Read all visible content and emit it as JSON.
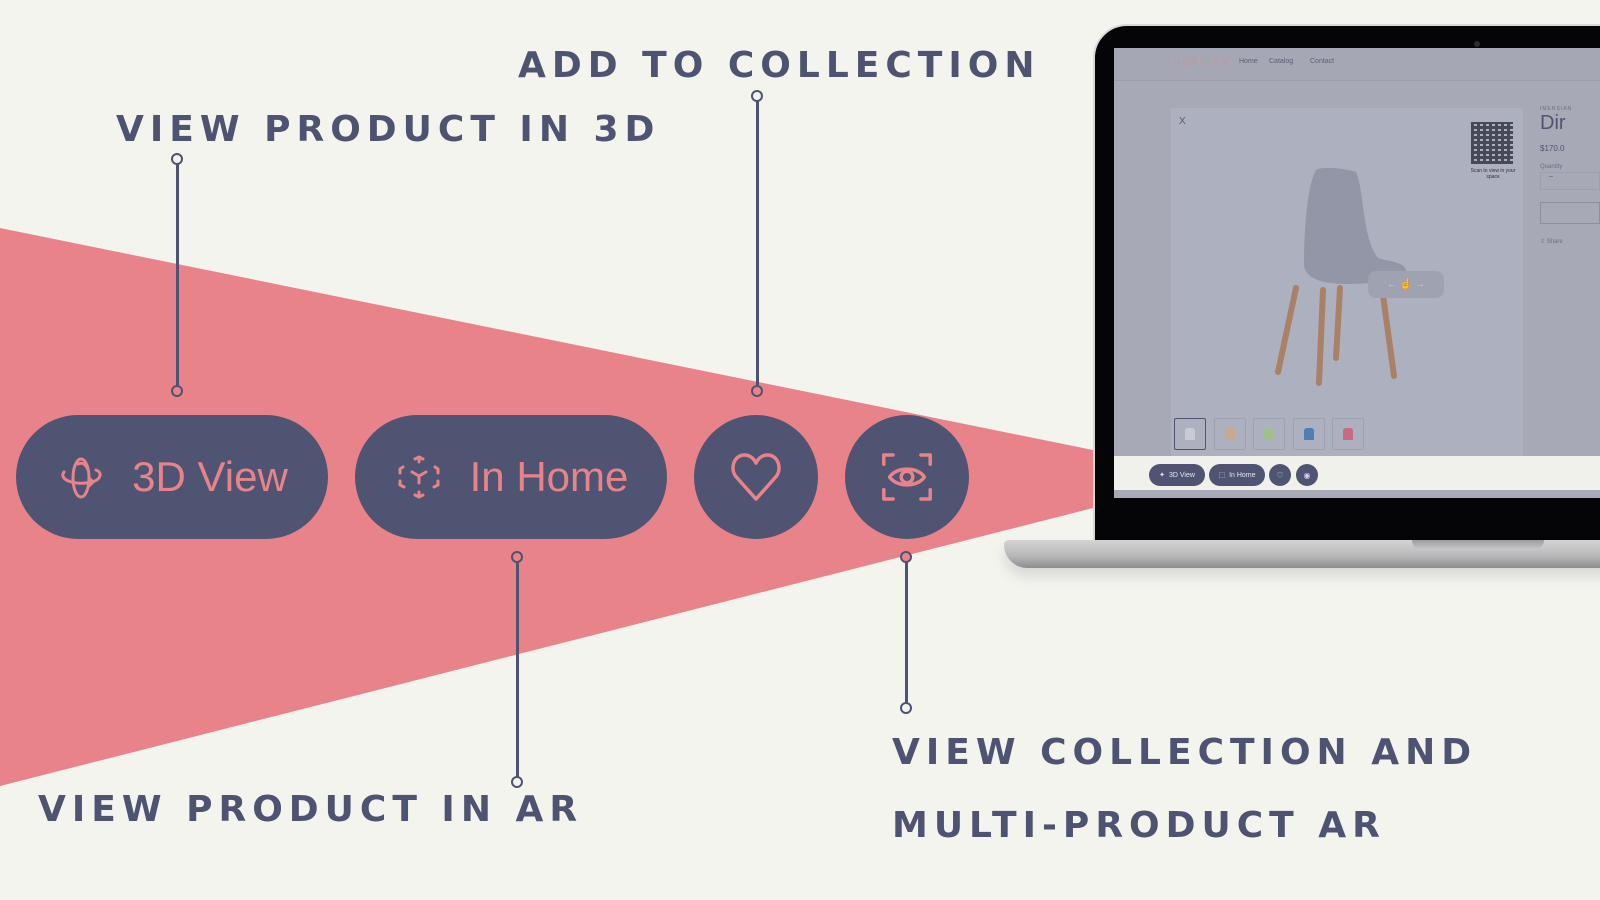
{
  "colors": {
    "background": "#f4f4ef",
    "accent_pink": "#e9838a",
    "navy": "#4f5472",
    "label_text": "#4d5370"
  },
  "callouts": {
    "view_3d": "VIEW PRODUCT IN 3D",
    "add_to_collection": "ADD TO COLLECTION",
    "view_ar": "VIEW PRODUCT IN AR",
    "view_collection_line1": "VIEW COLLECTION AND",
    "view_collection_line2": "MULTI-PRODUCT AR"
  },
  "buttons": {
    "view_3d": {
      "label": "3D View",
      "icon": "rotate-3d-icon"
    },
    "in_home": {
      "label": "In Home",
      "icon": "ar-cube-icon"
    },
    "favorite": {
      "icon": "heart-icon"
    },
    "view_collection": {
      "icon": "eye-scan-icon"
    }
  },
  "laptop_screen": {
    "logo": "IMERSIAN",
    "nav_links": [
      "Home",
      "Catalog",
      "Contact"
    ],
    "modal": {
      "close_label": "X",
      "qr_caption": "Scan to view in your space",
      "rotate_hint": "← ☝ →",
      "thumbnail_colors": [
        "#c9cbd4",
        "#c7a98f",
        "#9fc08b",
        "#4f7fb0",
        "#c96a82"
      ]
    },
    "product": {
      "brand": "IMERSIAN",
      "title": "Dir",
      "price": "$170.0",
      "quantity_label": "Quantity",
      "quantity_value": "–",
      "share_label": "⇪ Share"
    },
    "toolbar": {
      "view_3d_label": "3D View",
      "in_home_label": "In Home"
    }
  }
}
